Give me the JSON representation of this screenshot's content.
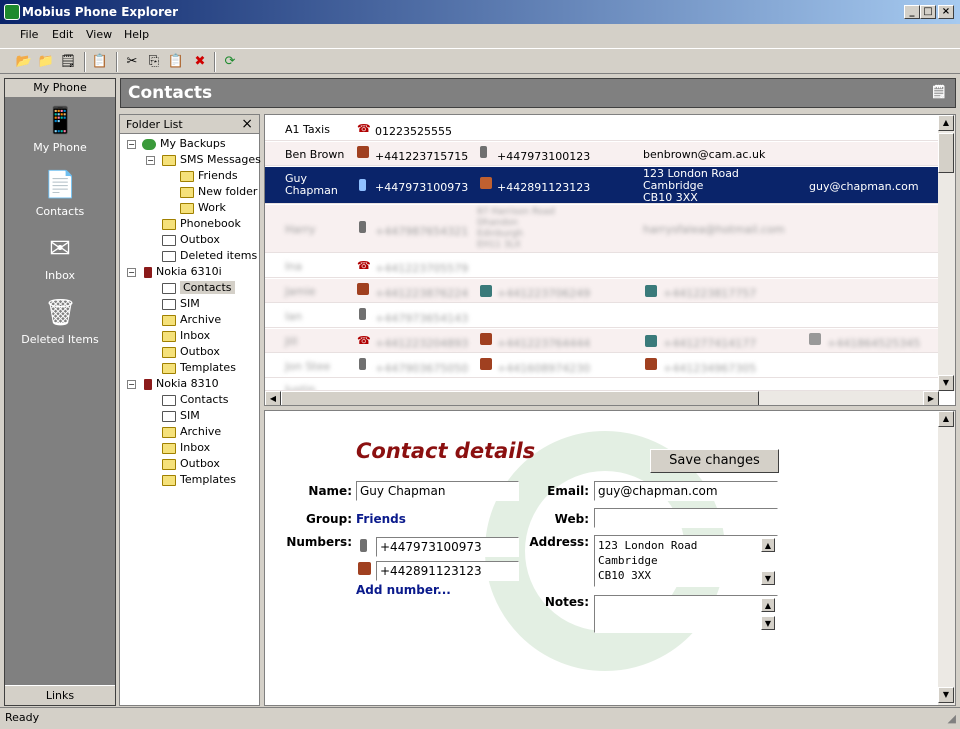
{
  "window": {
    "title": "Mobius Phone Explorer"
  },
  "menu": [
    "File",
    "Edit",
    "View",
    "Help"
  ],
  "sidebar": {
    "header": "My Phone",
    "footer": "Links",
    "items": [
      {
        "label": "My Phone"
      },
      {
        "label": "Contacts"
      },
      {
        "label": "Inbox"
      },
      {
        "label": "Deleted Items"
      }
    ]
  },
  "panel": {
    "title": "Contacts"
  },
  "folders": {
    "title": "Folder List",
    "items": [
      "My Backups",
      "SMS Messages",
      "Friends",
      "New folder",
      "Work",
      "Phonebook",
      "Outbox",
      "Deleted items",
      "Nokia 6310i",
      "Contacts",
      "SIM",
      "Archive",
      "Inbox",
      "Outbox",
      "Templates",
      "Nokia 8310",
      "Contacts",
      "SIM",
      "Archive",
      "Inbox",
      "Outbox",
      "Templates"
    ]
  },
  "contacts": [
    {
      "name": "A1 Taxis",
      "n1": "01223525555",
      "n2": "",
      "email": "",
      "other": ""
    },
    {
      "name": "Ben Brown",
      "n1": "+441223715715",
      "n2": "+447973100123",
      "email": "benbrown@cam.ac.uk",
      "other": ""
    },
    {
      "name": "Guy\nChapman",
      "n1": "+447973100973",
      "n2": "+442891123123",
      "email": "123 London Road\nCambridge\nCB10 3XX",
      "other": "guy@chapman.com"
    },
    {
      "name": "Harry",
      "n1": "+447987654321",
      "n2": "87 Harrison Road\nDhandon\nEdinburgh\nEH11 3LX",
      "email": "harrysfalea@hotmail.com",
      "other": ""
    },
    {
      "name": "Ina",
      "n1": "+441223705579",
      "n2": "",
      "email": "",
      "other": ""
    },
    {
      "name": "Jamie",
      "n1": "+441223876224",
      "n2": "+441223706249",
      "email": "+441223817757",
      "other": ""
    },
    {
      "name": "Ian",
      "n1": "+447973654143",
      "n2": "",
      "email": "",
      "other": ""
    },
    {
      "name": "Jill",
      "n1": "+441223204893",
      "n2": "+441223764444",
      "email": "+441277414177",
      "other": "+441864525345"
    },
    {
      "name": "Jon Stee",
      "n1": "+447903675050",
      "n2": "+441608974230",
      "email": "+441234967305",
      "other": ""
    },
    {
      "name": "Justin",
      "n1": "",
      "n2": "",
      "email": "",
      "other": ""
    }
  ],
  "details": {
    "heading": "Contact details",
    "save": "Save changes",
    "name_label": "Name:",
    "name": "Guy Chapman",
    "group_label": "Group:",
    "group": "Friends",
    "numbers_label": "Numbers:",
    "number1": "+447973100973",
    "number2": "+442891123123",
    "add_number": "Add number...",
    "email_label": "Email:",
    "email": "guy@chapman.com",
    "web_label": "Web:",
    "web": "",
    "address_label": "Address:",
    "address": "123 London Road\nCambridge\nCB10 3XX",
    "notes_label": "Notes:",
    "notes": ""
  },
  "status": "Ready",
  "colors": {
    "selection": "#0a246a",
    "heading": "#8b1010",
    "link": "#0a1a8c"
  }
}
